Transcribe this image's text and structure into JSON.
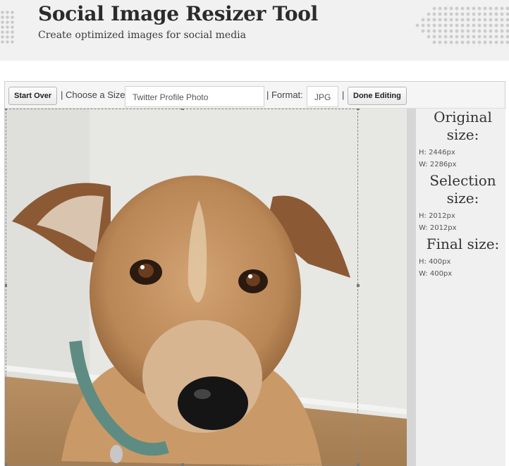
{
  "header": {
    "title": "Social Image Resizer Tool",
    "subtitle": "Create optimized images for social media"
  },
  "toolbar": {
    "start_over_label": "Start Over",
    "choose_size_label": "| Choose a Size:",
    "size_value": "Twitter Profile Photo",
    "format_label": "| Format:",
    "format_value": "JPG",
    "separator": "|",
    "done_label": "Done Editing"
  },
  "panel": {
    "original": {
      "heading_line1": "Original",
      "heading_line2": "size:",
      "height": "H: 2446px",
      "width": "W: 2286px"
    },
    "selection": {
      "heading_line1": "Selection",
      "heading_line2": "size:",
      "height": "H: 2012px",
      "width": "W: 2012px"
    },
    "final": {
      "heading": "Final size:",
      "height": "H: 400px",
      "width": "W: 400px"
    }
  },
  "image": {
    "subject": "dog-photo"
  }
}
